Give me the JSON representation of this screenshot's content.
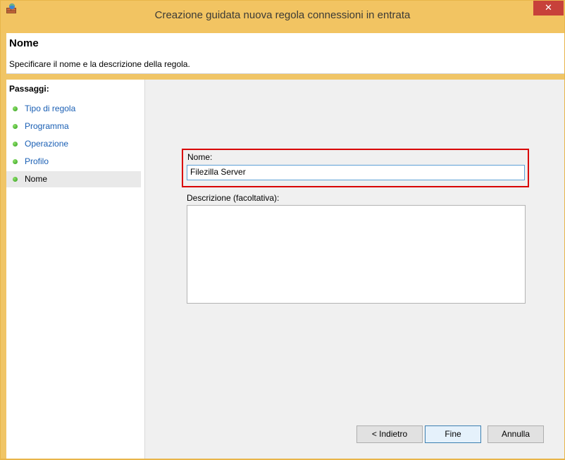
{
  "window": {
    "title": "Creazione guidata nuova regola connessioni in entrata",
    "close_label": "✕",
    "accent_color": "#f2c462"
  },
  "header": {
    "title": "Nome",
    "subtitle": "Specificare il nome e la descrizione della regola."
  },
  "steps": {
    "title": "Passaggi:",
    "items": [
      {
        "label": "Tipo di regola"
      },
      {
        "label": "Programma"
      },
      {
        "label": "Operazione"
      },
      {
        "label": "Profilo"
      },
      {
        "label": "Nome",
        "active": true
      }
    ]
  },
  "form": {
    "name_label": "Nome:",
    "name_value": "Filezilla Server",
    "description_label": "Descrizione (facoltativa):",
    "description_value": ""
  },
  "buttons": {
    "back": "< Indietro",
    "finish": "Fine",
    "cancel": "Annulla"
  }
}
